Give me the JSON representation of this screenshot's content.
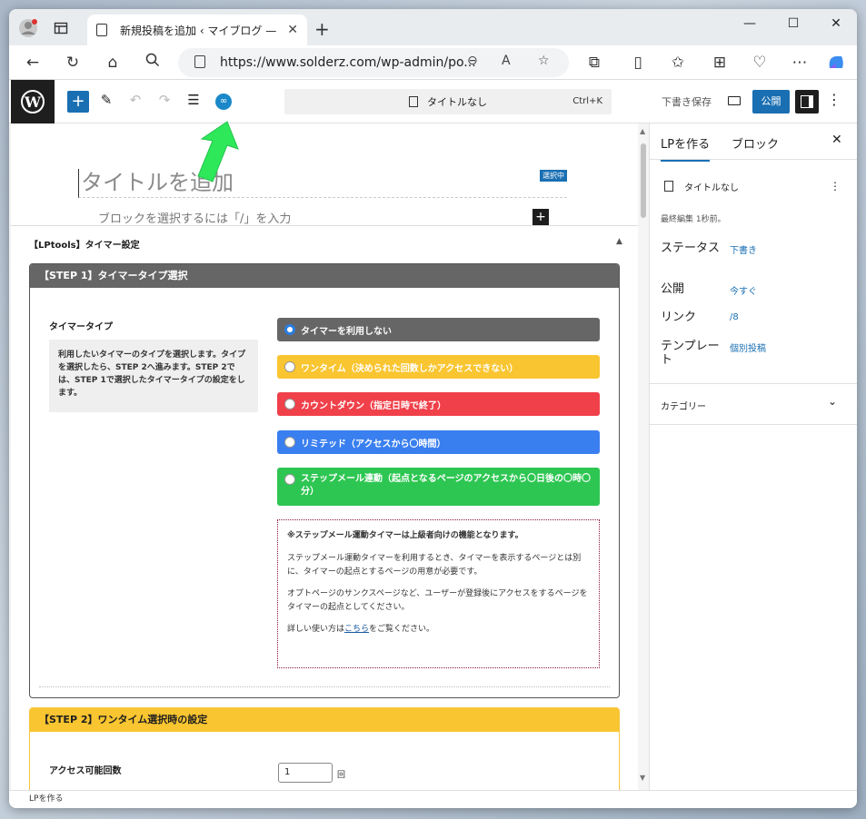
{
  "browser": {
    "tab_title": "新規投稿を追加 ‹ マイブログ — Wo…",
    "url": "https://www.solderz.com/wp-admin/po..."
  },
  "editor": {
    "doc_title": "タイトルなし",
    "shortcut": "Ctrl+K",
    "save_draft": "下書き保存",
    "publish": "公開",
    "title_placeholder": "タイトルを追加",
    "selected_badge": "選択中",
    "block_hint": "ブロックを選択するには「/」を入力"
  },
  "metabox": {
    "heading": "【LPtools】タイマー設定",
    "step1": {
      "header": "【STEP 1】タイマータイプ選択",
      "label": "タイマータイプ",
      "description": "利用したいタイマーのタイプを選択します。タイプを選択したら、STEP 2へ進みます。STEP 2では、STEP 1で選択したタイマータイプの設定をします。",
      "options": [
        {
          "label": "タイマーを利用しない",
          "color": "#666666",
          "selected": true
        },
        {
          "label": "ワンタイム（決められた回数しかアクセスできない）",
          "color": "#f9c530",
          "selected": false
        },
        {
          "label": "カウントダウン（指定日時で終了）",
          "color": "#f0404a",
          "selected": false
        },
        {
          "label": "リミテッド（アクセスから〇時間）",
          "color": "#3a7ff0",
          "selected": false
        },
        {
          "label": "ステップメール連動（起点となるページのアクセスから〇日後の〇時〇分）",
          "color": "#2ec652",
          "selected": false
        }
      ],
      "note": {
        "title": "※ステップメール運動タイマーは上級者向けの機能となります。",
        "p1": "ステップメール運動タイマーを利用するとき、タイマーを表示するページとは別に、タイマーの起点とするページの用意が必要です。",
        "p2": "オプトページのサンクスページなど、ユーザーが登録後にアクセスをするページをタイマーの起点としてください。",
        "p3_pre": "詳しい使い方は",
        "p3_link": "こちら",
        "p3_post": "をご覧ください。"
      }
    },
    "step2": {
      "header": "【STEP 2】ワンタイム選択時の設定",
      "label": "アクセス可能回数",
      "value": "1",
      "unit": "回"
    }
  },
  "sidebar": {
    "tab_lp": "LPを作る",
    "tab_block": "ブロック",
    "doc_title": "タイトルなし",
    "last_edited": "最終編集 1秒前。",
    "status_key": "ステータス",
    "status_val": "下書き",
    "publish_key": "公開",
    "publish_val": "今すぐ",
    "link_key": "リンク",
    "link_val": "/8",
    "template_key": "テンプレート",
    "template_val": "個別投稿",
    "category": "カテゴリー"
  },
  "footer": {
    "label": "LPを作る"
  },
  "colors": {
    "accent": "#1a6fb3",
    "arrow": "#2ee85a"
  }
}
